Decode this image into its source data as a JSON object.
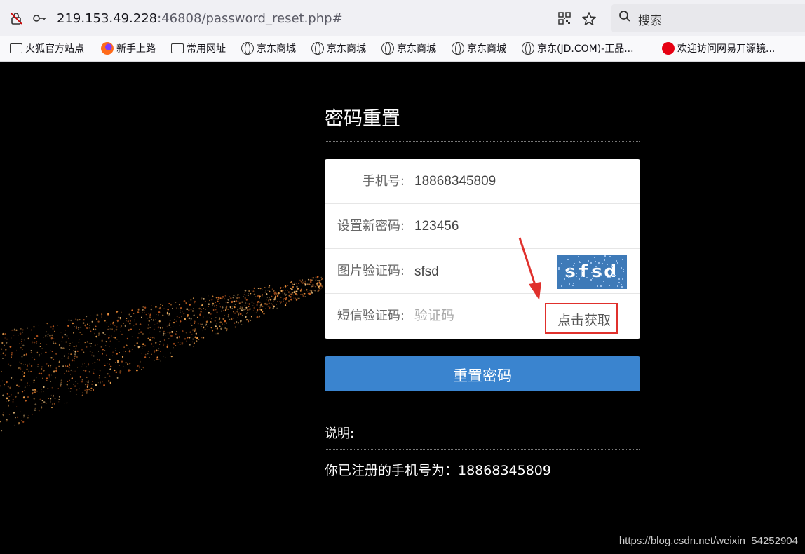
{
  "browser": {
    "url_host": "219.153.49.228",
    "url_rest": ":46808/password_reset.php#",
    "search_placeholder": "搜索",
    "bookmarks": [
      {
        "label": "火狐官方站点",
        "icon": "folder-icon"
      },
      {
        "label": "新手上路",
        "icon": "firefox-icon"
      },
      {
        "label": "常用网址",
        "icon": "folder-icon"
      },
      {
        "label": "京东商城",
        "icon": "globe-icon"
      },
      {
        "label": "京东商城",
        "icon": "globe-icon"
      },
      {
        "label": "京东商城",
        "icon": "globe-icon"
      },
      {
        "label": "京东商城",
        "icon": "globe-icon"
      },
      {
        "label": "京东(JD.COM)-正品...",
        "icon": "globe-icon"
      },
      {
        "label": "欢迎访问网易开源镜...",
        "icon": "netease-icon"
      }
    ]
  },
  "page": {
    "title": "密码重置",
    "form": {
      "phone_label": "手机号:",
      "phone_value": "18868345809",
      "password_label": "设置新密码:",
      "password_value": "123456",
      "captcha_label": "图片验证码:",
      "captcha_value": "sfsd",
      "captcha_image_text": "sfsd",
      "sms_label": "短信验证码:",
      "sms_placeholder": "验证码",
      "get_code_label": "点击获取"
    },
    "submit_label": "重置密码",
    "note_label": "说明:",
    "note_text": "你已注册的手机号为：18868345809"
  },
  "watermark": "https://blog.csdn.net/weixin_54252904",
  "colors": {
    "background": "#000000",
    "submit": "#3a84cf",
    "highlight": "#e0302c",
    "captcha_bg": "#3e7ab8"
  }
}
